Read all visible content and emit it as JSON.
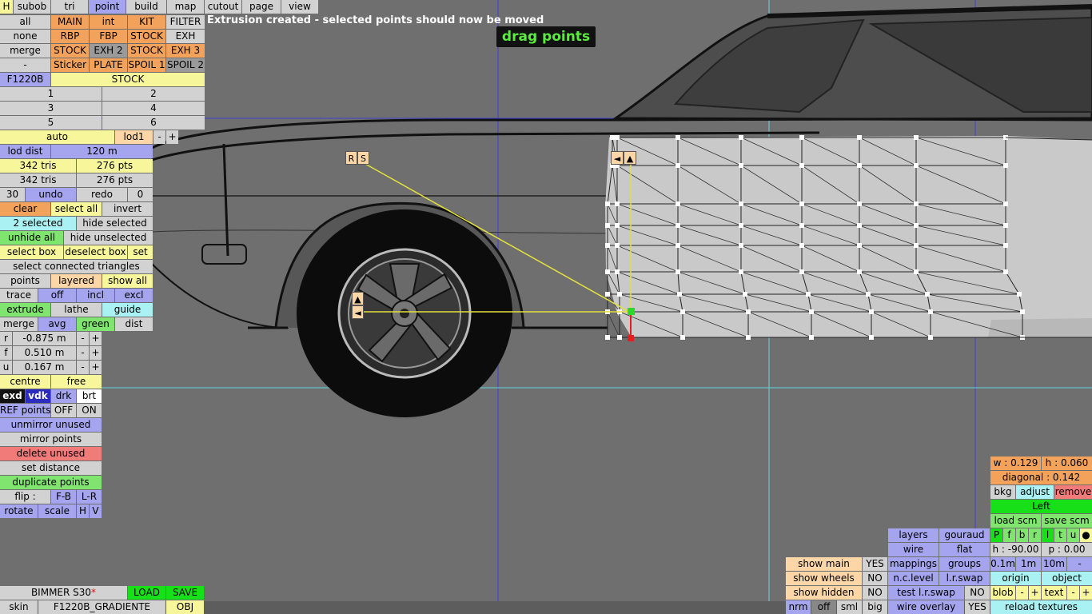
{
  "top_tabs": [
    "H",
    "subob",
    "tri",
    "point",
    "build",
    "map",
    "cutout",
    "page",
    "view"
  ],
  "status_message": "Extrusion created - selected points should now be moved",
  "mode_badge": "drag points",
  "left_panel": {
    "filter_row": [
      "all",
      "MAIN",
      "int",
      "KIT",
      "FILTER"
    ],
    "row2": [
      "none",
      "RBP",
      "FBP",
      "STOCK",
      "EXH"
    ],
    "row3": [
      "merge",
      "STOCK",
      "EXH 2",
      "STOCK",
      "EXH 3"
    ],
    "row4": [
      "-",
      "Sticker",
      "PLATE",
      "SPOIL 1",
      "SPOIL 2"
    ],
    "part_name": "F1220B",
    "part_value": "STOCK",
    "nums": [
      "1",
      "2",
      "3",
      "4",
      "5",
      "6"
    ],
    "lod_auto": "auto",
    "lod_value": "lod1",
    "minus": "-",
    "plus": "+",
    "lod_dist_label": "lod dist",
    "lod_dist_value": "120 m",
    "tris1": "342 tris",
    "pts1": "276 pts",
    "tris2": "342 tris",
    "pts2": "276 pts",
    "undo_count": "30",
    "undo": "undo",
    "redo": "redo",
    "redo_count": "0",
    "clear": "clear",
    "select_all": "select all",
    "invert": "invert",
    "selected": "2 selected",
    "hide_selected": "hide selected",
    "unhide_all": "unhide all",
    "hide_unselected": "hide unselected",
    "select_box": "select box",
    "deselect_box": "deselect box",
    "set": "set",
    "select_connected": "select connected triangles",
    "points": "points",
    "layered": "layered",
    "show_all": "show all",
    "trace": "trace",
    "off": "off",
    "incl": "incl",
    "excl": "excl",
    "extrude": "extrude",
    "lathe": "lathe",
    "guide": "guide",
    "merge2": "merge",
    "avg": "avg",
    "green": "green",
    "dist": "dist",
    "r_label": "r",
    "r_value": "-0.875 m",
    "f_label": "f",
    "f_value": "0.510 m",
    "u_label": "u",
    "u_value": "0.167 m",
    "centre": "centre",
    "free": "free",
    "exd": "exd",
    "vdk": "vdk",
    "drk": "drk",
    "brt": "brt",
    "ref_points": "REF points",
    "ref_off": "OFF",
    "ref_on": "ON",
    "unmirror_unused": "unmirror unused",
    "mirror_points": "mirror points",
    "delete_unused": "delete unused",
    "set_distance": "set distance",
    "duplicate_points": "duplicate points",
    "flip": "flip :",
    "flip_fb": "F-B",
    "flip_lr": "L-R",
    "rotate": "rotate",
    "scale": "scale",
    "h": "H",
    "v": "V"
  },
  "bottom_left": {
    "car_name": "BIMMER S30",
    "modified_mark": "*",
    "load": "LOAD",
    "save": "SAVE",
    "skin": "skin",
    "skin_name": "F1220B_GRADIENTE",
    "obj": "OBJ"
  },
  "view_controls": {
    "rs_r": "R",
    "rs_s": "S",
    "arrow_left": "◄",
    "arrow_up": "▲"
  },
  "bottom_right": {
    "w": "w : 0.129",
    "h": "h : 0.060",
    "diagonal": "diagonal : 0.142",
    "bkg": "bkg",
    "adjust": "adjust",
    "remove": "remove",
    "left": "Left",
    "load_scm": "load scm",
    "save_scm": "save scm",
    "letters": [
      "P",
      "f",
      "b",
      "r",
      "l",
      "t",
      "u"
    ],
    "dot": "●",
    "layers": "layers",
    "gouraud": "gouraud",
    "wire": "wire",
    "flat": "flat",
    "h_angle": "h : -90.00",
    "p_angle": "p : 0.00",
    "show_main": "show main",
    "yes": "YES",
    "mappings": "mappings",
    "groups": "groups",
    "step1": "0.1m",
    "step2": "1m",
    "step3": "10m",
    "step_minus": "-",
    "show_wheels": "show wheels",
    "no": "NO",
    "nc_level": "n.c.level",
    "lr_swap": "l.r.swap",
    "origin": "origin",
    "object": "object",
    "show_hidden": "show hidden",
    "test_lr_swap": "test l.r.swap",
    "blob": "blob",
    "text": "text",
    "nrm": "nrm",
    "off": "off",
    "sml": "sml",
    "big": "big",
    "wire_overlay": "wire overlay",
    "reload_textures": "reload textures"
  }
}
